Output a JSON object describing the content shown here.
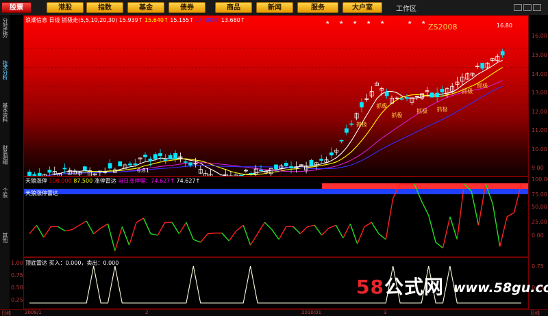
{
  "toolbar": {
    "buttons": [
      "股票",
      "港股",
      "指数",
      "基金",
      "债券",
      "商品",
      "新闻",
      "服务",
      "大户室"
    ],
    "workspace_label": "工作区"
  },
  "left_tabs": [
    {
      "label": "分时走势",
      "selected": false
    },
    {
      "label": "技术分析",
      "selected": true
    },
    {
      "label": "基本资料",
      "selected": false
    },
    {
      "label": "财务明细",
      "selected": false
    },
    {
      "label": "个股",
      "selected": false
    },
    {
      "label": "其他",
      "selected": false
    }
  ],
  "main_panel": {
    "stock_name": "浪潮信息",
    "period": "日线",
    "indicator": "抓极走(5,5,10,20,30)",
    "ma_values": [
      "15.939↑",
      "15.640↑",
      "15.155↑",
      "14.980↑",
      "13.680↑"
    ],
    "signal_label": "抓极",
    "high_label": "16.80",
    "low_label": "6.81",
    "overlay_text": "ZS2008",
    "y_ticks": [
      "16.00",
      "15.00",
      "14.00",
      "13.00",
      "12.00",
      "11.00",
      "10.00",
      "9.00"
    ],
    "colors": {
      "ma5": "#ffffff",
      "ma10": "#ffff00",
      "ma20": "#d020d0",
      "ma30": "#3030ff",
      "up": "#ff3030",
      "down": "#00ffff"
    }
  },
  "sub_panel1": {
    "title": "天狼涨停",
    "title_values": [
      "100.000",
      "87.500",
      "涨停雷达",
      "当日涨停幅：74.627↑",
      "74.627↑"
    ],
    "subtitle": "天狼涨停雷达",
    "y_ticks": [
      "100.00",
      "75.00",
      "50.00",
      "25.00",
      "0.00"
    ],
    "chart_data": {
      "type": "line",
      "title": "天狼涨停雷达",
      "ylim": [
        0,
        100
      ],
      "x": [
        1,
        2,
        3,
        4,
        5,
        6,
        7,
        8,
        9,
        10,
        11,
        12,
        13,
        14,
        15,
        16,
        17,
        18,
        19,
        20,
        21,
        22,
        23,
        24,
        25,
        26,
        27,
        28,
        29,
        30,
        31,
        32,
        33,
        34,
        35,
        36,
        37,
        38,
        39,
        40,
        41,
        42,
        43,
        44,
        45,
        46,
        47,
        48,
        49,
        50,
        51,
        52,
        53,
        54,
        55,
        56,
        57,
        58,
        59,
        60,
        61,
        62,
        63,
        64,
        65,
        66,
        67,
        68,
        69,
        70
      ],
      "series": [
        {
          "name": "天狼涨停",
          "values": [
            30,
            42,
            25,
            40,
            40,
            34,
            36,
            42,
            48,
            30,
            38,
            44,
            6,
            40,
            14,
            46,
            52,
            30,
            28,
            46,
            46,
            30,
            46,
            22,
            18,
            30,
            31,
            31,
            20,
            34,
            42,
            14,
            30,
            46,
            36,
            22,
            40,
            40,
            30,
            40,
            42,
            28,
            38,
            42,
            24,
            44,
            16,
            40,
            46,
            30,
            22,
            80,
            100,
            100,
            100,
            76,
            56,
            18,
            10,
            54,
            22,
            100,
            90,
            42,
            100,
            72,
            12,
            54,
            60,
            100
          ]
        }
      ]
    }
  },
  "sub_panel2": {
    "title": "顶底雷达",
    "buy_text": "买入：0.000，卖出：0.000",
    "y_ticks": [
      "1.00",
      "0.75",
      "0.50",
      "0.25"
    ],
    "chart_data": {
      "type": "line",
      "title": "顶底雷达",
      "ylim": [
        0,
        1
      ],
      "series": [
        {
          "name": "买入",
          "values": [
            0,
            0,
            0,
            0,
            0,
            0,
            0,
            0,
            0,
            1,
            0,
            0,
            1,
            0,
            0,
            0,
            0,
            0,
            0,
            0,
            0,
            0,
            0,
            1,
            0,
            0,
            0,
            0,
            0,
            0,
            0,
            1,
            0,
            0,
            0,
            0,
            0,
            0,
            0,
            0,
            0,
            0,
            0,
            0,
            0,
            0,
            0,
            0,
            0,
            0,
            0,
            1,
            0,
            0,
            0,
            0,
            1,
            0,
            0,
            1,
            0,
            0,
            0,
            0,
            0,
            0,
            0,
            0,
            0,
            0
          ]
        }
      ]
    }
  },
  "bottom_bar": [
    "日线",
    "2009/1",
    "2",
    "2010/01",
    "3",
    "日线"
  ],
  "watermark": {
    "logo_num": "58",
    "logo_cn": "公式网",
    "url": "www.58gu.com"
  }
}
